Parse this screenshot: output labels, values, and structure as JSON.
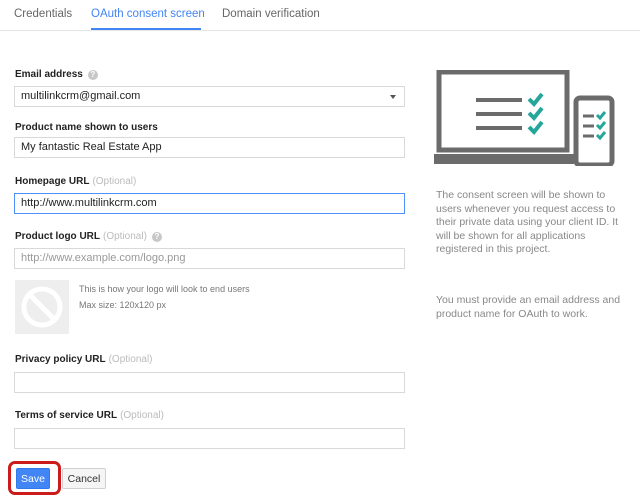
{
  "tabs": [
    "Credentials",
    "OAuth consent screen",
    "Domain verification"
  ],
  "form": {
    "email_label": "Email address",
    "email_value": "multilinkcrm@gmail.com",
    "product_label": "Product name shown to users",
    "product_value": "My fantastic Real Estate App",
    "homepage_label": "Homepage URL",
    "optional_text": "(Optional)",
    "homepage_value": "http://www.multilinkcrm.com",
    "logo_label": "Product logo URL",
    "logo_placeholder": "http://www.example.com/logo.png",
    "logo_note_line1": "This is how your logo will look to end users",
    "logo_note_line2": "Max size: 120x120 px",
    "privacy_label": "Privacy policy URL",
    "privacy_value": "",
    "terms_label": "Terms of service URL",
    "terms_value": "",
    "help_glyph": "?"
  },
  "side": {
    "paragraph1": "The consent screen will be shown to users whenever you request access to their private data using your client ID. It will be shown for all applications registered in this project.",
    "paragraph2": "You must provide an email address and product name for OAuth to work."
  },
  "buttons": {
    "save": "Save",
    "cancel": "Cancel"
  },
  "colors": {
    "accent": "#4285f4",
    "highlight": "#cc1b1b",
    "check": "#26a69a"
  },
  "icons": [
    "help-icon",
    "dropdown-arrow-icon",
    "no-logo-icon",
    "laptop-illustration-icon",
    "phone-illustration-icon",
    "checkmark-icon"
  ]
}
